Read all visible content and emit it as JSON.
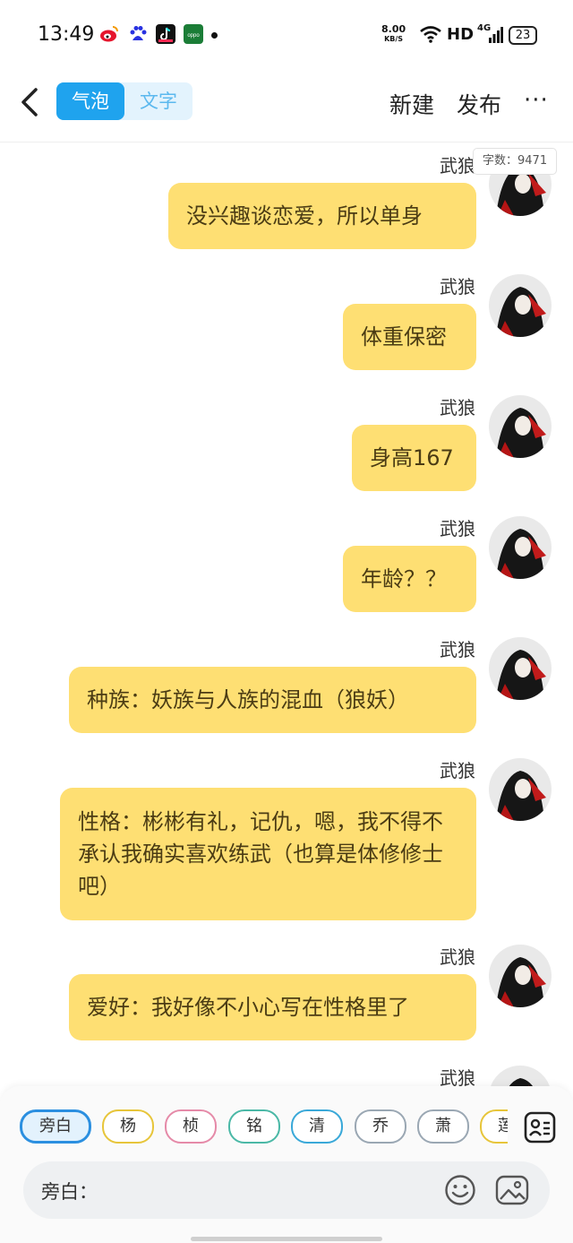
{
  "status_bar": {
    "time": "13:49",
    "app_icons": [
      "weibo-icon",
      "baidu-icon",
      "douyin-icon",
      "oppo-icon"
    ],
    "net_speed_value": "8.00",
    "net_speed_unit": "KB/S",
    "hd": "HD",
    "network": "4G",
    "battery": "23"
  },
  "header": {
    "tabs": [
      {
        "label": "气泡",
        "active": true
      },
      {
        "label": "文字",
        "active": false
      }
    ],
    "new_label": "新建",
    "publish_label": "发布",
    "more_label": "···"
  },
  "word_count": "字数：9471",
  "messages": [
    {
      "name": "武狼",
      "text": "没兴趣谈恋爱，所以单身"
    },
    {
      "name": "武狼",
      "text": "体重保密"
    },
    {
      "name": "武狼",
      "text": "身高167"
    },
    {
      "name": "武狼",
      "text": "年龄？？"
    },
    {
      "name": "武狼",
      "text": "种族：妖族与人族的混血（狼妖）"
    },
    {
      "name": "武狼",
      "text": "性格：彬彬有礼，记仇，嗯，我不得不承认我确实喜欢练武（也算是体修修士吧）"
    },
    {
      "name": "武狼",
      "text": "爱好：我好像不小心写在性格里了"
    },
    {
      "name": "武狼",
      "text": ""
    }
  ],
  "characters": [
    {
      "label": "旁白",
      "color": "#2b8fe0",
      "selected": true
    },
    {
      "label": "杨",
      "color": "#e7c53a"
    },
    {
      "label": "桢",
      "color": "#e58aa8"
    },
    {
      "label": "铭",
      "color": "#4ab8a6"
    },
    {
      "label": "清",
      "color": "#39a8d8"
    },
    {
      "label": "乔",
      "color": "#9aa7b3"
    },
    {
      "label": "萧",
      "color": "#9aa7b3"
    },
    {
      "label": "莲",
      "color": "#e7c53a"
    }
  ],
  "input": {
    "label": "旁白："
  }
}
